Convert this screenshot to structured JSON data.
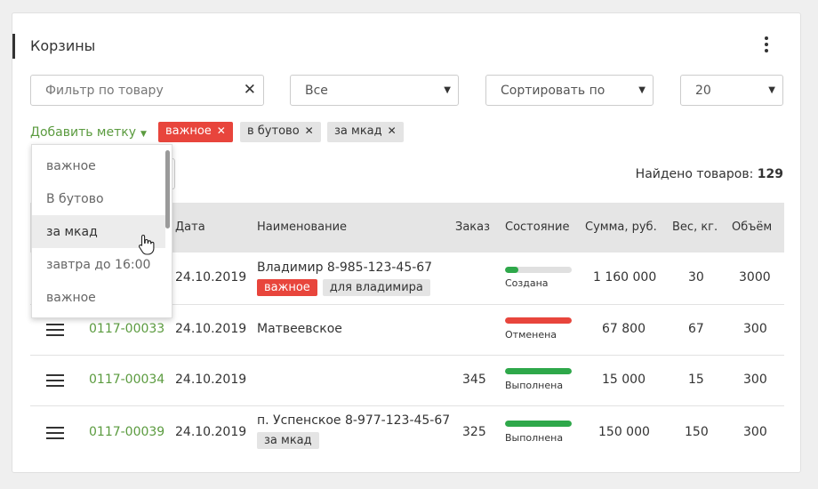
{
  "title": "Корзины",
  "filters": {
    "product_placeholder": "Фильтр по товару",
    "status_value": "Все",
    "sort_value": "Сортировать по",
    "page_size_value": "20"
  },
  "tags_bar": {
    "add_label": "Добавить метку",
    "chips": [
      "важное",
      "в бутово",
      "за мкад"
    ]
  },
  "dropdown": {
    "items": [
      "важное",
      "В бутово",
      "за мкад",
      "завтра до 16:00",
      "важное"
    ],
    "hovered_index": 2
  },
  "found": {
    "label": "Найдено товаров:",
    "count": "129"
  },
  "table": {
    "headers": [
      "Дата",
      "Наименование",
      "Заказ",
      "Состояние",
      "Сумма, руб.",
      "Вес, кг.",
      "Объём"
    ],
    "rows": [
      {
        "number": "",
        "date": "24.10.2019",
        "name": "Владимир 8-985-123-45-67",
        "tags": [
          "важное",
          "для владимира"
        ],
        "order": "",
        "status": "Создана",
        "progress": 0.2,
        "status_color": "#2ea84a",
        "sum": "1 160 000",
        "weight": "30",
        "volume": "3000"
      },
      {
        "number": "0117-00033",
        "date": "24.10.2019",
        "name": "Матвеевское",
        "tags": [],
        "order": "",
        "status": "Отменена",
        "progress": 1.0,
        "status_color": "#e8453c",
        "sum": "67 800",
        "weight": "67",
        "volume": "300"
      },
      {
        "number": "0117-00034",
        "date": "24.10.2019",
        "name": "",
        "tags": [],
        "order": "345",
        "status": "Выполнена",
        "progress": 1.0,
        "status_color": "#2ea84a",
        "sum": "15 000",
        "weight": "15",
        "volume": "300"
      },
      {
        "number": "0117-00039",
        "date": "24.10.2019",
        "name": "п. Успенское 8-977-123-45-67",
        "tags": [
          "за мкад"
        ],
        "order": "325",
        "status": "Выполнена",
        "progress": 1.0,
        "status_color": "#2ea84a",
        "sum": "150 000",
        "weight": "150",
        "volume": "300"
      }
    ]
  },
  "colors": {
    "accent_green": "#5b9b3f",
    "tag_red": "#e8453c",
    "status_green": "#2ea84a"
  }
}
